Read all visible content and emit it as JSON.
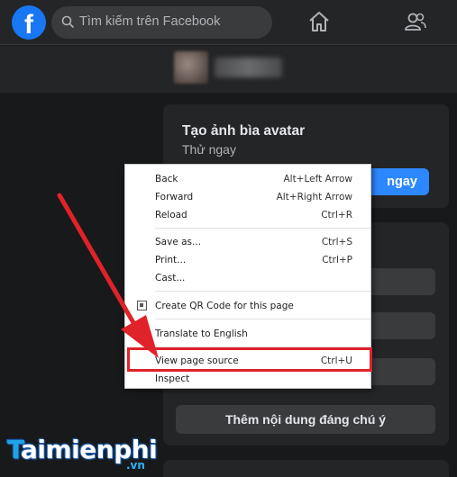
{
  "topbar": {
    "logo": "f",
    "search_placeholder": "Tìm kiếm trên Facebook",
    "icons": [
      "facebook-logo",
      "search-icon",
      "home-icon",
      "friends-icon"
    ]
  },
  "cards": {
    "avatar_frame": {
      "title": "Tạo ảnh bìa avatar",
      "subtitle": "Thử ngay",
      "button_partial": "ngay"
    },
    "feature": {
      "button": "Thêm nội dung đáng chú ý"
    }
  },
  "context_menu": {
    "items": [
      {
        "label": "Back",
        "shortcut": "Alt+Left Arrow"
      },
      {
        "label": "Forward",
        "shortcut": "Alt+Right Arrow"
      },
      {
        "label": "Reload",
        "shortcut": "Ctrl+R"
      },
      {
        "label": "Save as...",
        "shortcut": "Ctrl+S"
      },
      {
        "label": "Print...",
        "shortcut": "Ctrl+P"
      },
      {
        "label": "Cast...",
        "shortcut": ""
      },
      {
        "label": "Create QR Code for this page",
        "shortcut": ""
      },
      {
        "label": "Translate to English",
        "shortcut": ""
      },
      {
        "label": "View page source",
        "shortcut": "Ctrl+U"
      },
      {
        "label": "Inspect",
        "shortcut": ""
      }
    ],
    "highlighted": "View page source"
  },
  "watermark": {
    "brand_initial": "T",
    "brand_rest": "aimienphi",
    "domain": ".vn"
  },
  "colors": {
    "fb_blue": "#1877f2",
    "highlight_red": "#e0222a",
    "background": "#18191a"
  }
}
